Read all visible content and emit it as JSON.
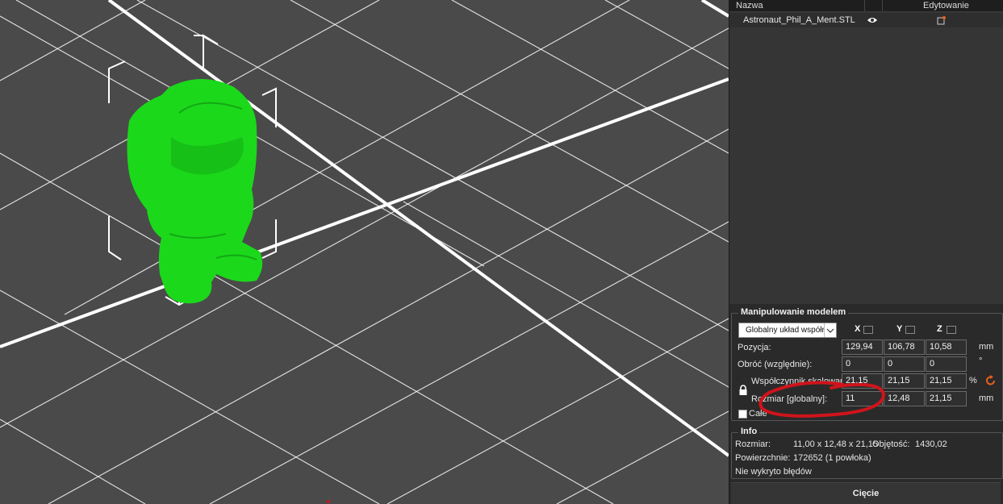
{
  "object_list": {
    "columns": [
      "Nazwa",
      "Edytowanie"
    ],
    "items": [
      {
        "name": "Astronaut_Phil_A_Ment.STL",
        "visibility_icon": "eye-icon",
        "edit_icon": "edit-settings-icon"
      }
    ]
  },
  "manipulation": {
    "title": "Manipulowanie modelem",
    "coord_system": "Globalny układ współrzędnych",
    "axes": [
      "X",
      "Y",
      "Z"
    ],
    "rows": [
      {
        "label": "Pozycja:",
        "values": [
          "129,94",
          "106,78",
          "10,58"
        ],
        "unit": "mm"
      },
      {
        "label": "Obróć (względnie):",
        "values": [
          "0",
          "0",
          "0"
        ],
        "unit": "°"
      },
      {
        "label": "Współczynnik skalowania:",
        "values": [
          "21,15",
          "21,15",
          "21,15"
        ],
        "unit": "%"
      },
      {
        "label": "Rozmiar [globalny]:",
        "values": [
          "11",
          "12,48",
          "21,15"
        ],
        "unit": "mm"
      }
    ],
    "uniform_label": "Całe",
    "uniform_checked": false,
    "highlight_color": "#d0141b"
  },
  "info": {
    "title": "Info",
    "size_label": "Rozmiar:",
    "size_value": "11,00 x 12,48 x 21,15",
    "volume_label": "Objętość:",
    "volume_value": "1430,02",
    "surface_label": "Powierzchnie:",
    "surface_value": "172652 (1 powłoka)",
    "errors": "Nie wykryto błędów"
  },
  "slice_button": "Cięcie",
  "colors": {
    "model": "#1bd81b",
    "viewport_bg": "#4a4a4a",
    "grid": "#ffffff",
    "accent_reset": "#e8621f"
  }
}
